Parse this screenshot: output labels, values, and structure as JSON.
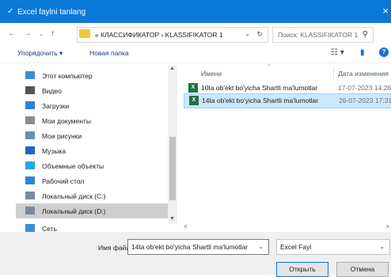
{
  "window": {
    "title": "Excel faylni tanlang",
    "close_glyph": "×",
    "app_icon": "✓"
  },
  "address": {
    "path": "« КЛАССИФИКАТОР  ›  KLASSIFIKATOR 1",
    "search_placeholder": "Поиск: KLASSIFIKATOR 1"
  },
  "toolbar": {
    "organize_label": "Упорядочить ▾",
    "new_folder_label": "Новая папка",
    "help_label": "?"
  },
  "nav": {
    "items": [
      {
        "label": "Этот компьютер",
        "icon": "computer-icon",
        "color": "#3a8fd8"
      },
      {
        "label": "Видео",
        "icon": "video-icon",
        "color": "#555555"
      },
      {
        "label": "Загрузки",
        "icon": "download-icon",
        "color": "#2f7fd6"
      },
      {
        "label": "Мои документы",
        "icon": "documents-icon",
        "color": "#8c8c8c"
      },
      {
        "label": "Мои рисунки",
        "icon": "pictures-icon",
        "color": "#6a8db8"
      },
      {
        "label": "Музыка",
        "icon": "music-icon",
        "color": "#1a66c9"
      },
      {
        "label": "Объемные объекты",
        "icon": "3d-objects-icon",
        "color": "#2aa7d8"
      },
      {
        "label": "Рабочий стол",
        "icon": "desktop-icon",
        "color": "#2b86d8"
      },
      {
        "label": "Локальный диск (C:)",
        "icon": "drive-c-icon",
        "color": "#7a8a9a"
      },
      {
        "label": "Локальный диск (D:)",
        "icon": "drive-d-icon",
        "color": "#7a8a9a"
      },
      {
        "label": "Сеть",
        "icon": "network-icon",
        "color": "#3a8fd8"
      }
    ]
  },
  "filelist": {
    "col_name": "Имени",
    "col_date": "Дата изменения",
    "files": [
      {
        "name": "10ta ob'ekt bo'yicha Shartli ma'lumotlar",
        "date": "17-07-2023 14:26"
      },
      {
        "name": "14ta ob'ekt bo'yicha Shartli ma'lumotlar",
        "date": "26-07-2023 17:31"
      }
    ]
  },
  "bottom": {
    "filename_label": "Имя файла:",
    "filename_value": "14ta ob'ekt bo'yicha Shartli ma'lumotlar",
    "filetype_value": "Excel Fayl",
    "open_label": "Открыть",
    "cancel_label": "Отмена"
  }
}
